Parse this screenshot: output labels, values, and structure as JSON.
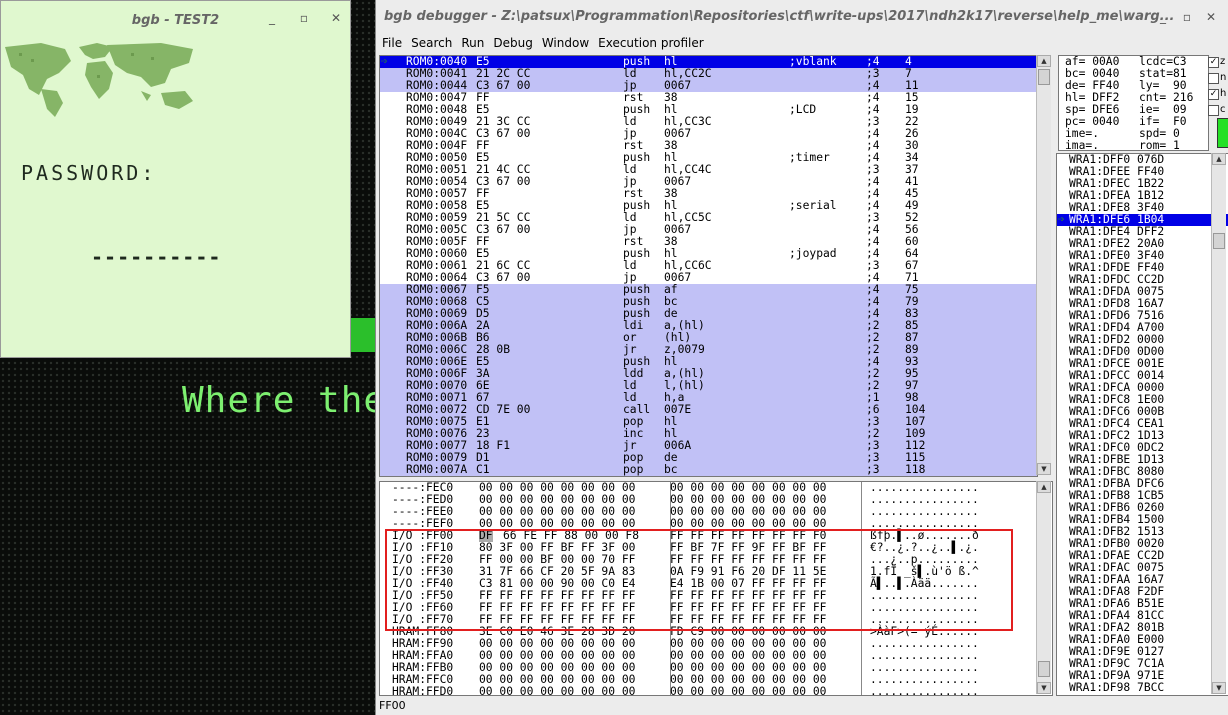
{
  "background": {
    "terminal_text": "Where the"
  },
  "emulator": {
    "title": "bgb - TEST2",
    "password_label": "PASSWORD:",
    "password_value": "----------"
  },
  "debugger": {
    "title": "bgb debugger - Z:\\patsux\\Programmation\\Repositories\\ctf\\write-ups\\2017\\ndh2k17\\reverse\\help_me\\warg...",
    "menu": [
      "File",
      "Search",
      "Run",
      "Debug",
      "Window",
      "Execution profiler"
    ],
    "menu_underline": [
      "F",
      "S",
      "R",
      "D",
      "W",
      "E"
    ],
    "status": "FF00"
  },
  "code_rows": [
    {
      "addr": "ROM0:0040",
      "bytes": "E5",
      "mn": "push",
      "op": "hl",
      "cm": ";vblank",
      "cy": ";4",
      "tot": "4",
      "style": "sel",
      "pc": true
    },
    {
      "addr": "ROM0:0041",
      "bytes": "21 2C CC",
      "mn": "ld",
      "op": "hl,CC2C",
      "cm": "",
      "cy": ";3",
      "tot": "7",
      "style": "hl"
    },
    {
      "addr": "ROM0:0044",
      "bytes": "C3 67 00",
      "mn": "jp",
      "op": "0067",
      "cm": "",
      "cy": ";4",
      "tot": "11",
      "style": "hl"
    },
    {
      "addr": "ROM0:0047",
      "bytes": "FF",
      "mn": "rst",
      "op": "38",
      "cm": "",
      "cy": ";4",
      "tot": "15",
      "style": ""
    },
    {
      "addr": "ROM0:0048",
      "bytes": "E5",
      "mn": "push",
      "op": "hl",
      "cm": ";LCD",
      "cy": ";4",
      "tot": "19",
      "style": ""
    },
    {
      "addr": "ROM0:0049",
      "bytes": "21 3C CC",
      "mn": "ld",
      "op": "hl,CC3C",
      "cm": "",
      "cy": ";3",
      "tot": "22",
      "style": ""
    },
    {
      "addr": "ROM0:004C",
      "bytes": "C3 67 00",
      "mn": "jp",
      "op": "0067",
      "cm": "",
      "cy": ";4",
      "tot": "26",
      "style": ""
    },
    {
      "addr": "ROM0:004F",
      "bytes": "FF",
      "mn": "rst",
      "op": "38",
      "cm": "",
      "cy": ";4",
      "tot": "30",
      "style": ""
    },
    {
      "addr": "ROM0:0050",
      "bytes": "E5",
      "mn": "push",
      "op": "hl",
      "cm": ";timer",
      "cy": ";4",
      "tot": "34",
      "style": ""
    },
    {
      "addr": "ROM0:0051",
      "bytes": "21 4C CC",
      "mn": "ld",
      "op": "hl,CC4C",
      "cm": "",
      "cy": ";3",
      "tot": "37",
      "style": ""
    },
    {
      "addr": "ROM0:0054",
      "bytes": "C3 67 00",
      "mn": "jp",
      "op": "0067",
      "cm": "",
      "cy": ";4",
      "tot": "41",
      "style": ""
    },
    {
      "addr": "ROM0:0057",
      "bytes": "FF",
      "mn": "rst",
      "op": "38",
      "cm": "",
      "cy": ";4",
      "tot": "45",
      "style": ""
    },
    {
      "addr": "ROM0:0058",
      "bytes": "E5",
      "mn": "push",
      "op": "hl",
      "cm": ";serial",
      "cy": ";4",
      "tot": "49",
      "style": ""
    },
    {
      "addr": "ROM0:0059",
      "bytes": "21 5C CC",
      "mn": "ld",
      "op": "hl,CC5C",
      "cm": "",
      "cy": ";3",
      "tot": "52",
      "style": ""
    },
    {
      "addr": "ROM0:005C",
      "bytes": "C3 67 00",
      "mn": "jp",
      "op": "0067",
      "cm": "",
      "cy": ";4",
      "tot": "56",
      "style": ""
    },
    {
      "addr": "ROM0:005F",
      "bytes": "FF",
      "mn": "rst",
      "op": "38",
      "cm": "",
      "cy": ";4",
      "tot": "60",
      "style": ""
    },
    {
      "addr": "ROM0:0060",
      "bytes": "E5",
      "mn": "push",
      "op": "hl",
      "cm": ";joypad",
      "cy": ";4",
      "tot": "64",
      "style": ""
    },
    {
      "addr": "ROM0:0061",
      "bytes": "21 6C CC",
      "mn": "ld",
      "op": "hl,CC6C",
      "cm": "",
      "cy": ";3",
      "tot": "67",
      "style": ""
    },
    {
      "addr": "ROM0:0064",
      "bytes": "C3 67 00",
      "mn": "jp",
      "op": "0067",
      "cm": "",
      "cy": ";4",
      "tot": "71",
      "style": ""
    },
    {
      "addr": "ROM0:0067",
      "bytes": "F5",
      "mn": "push",
      "op": "af",
      "cm": "",
      "cy": ";4",
      "tot": "75",
      "style": "hl"
    },
    {
      "addr": "ROM0:0068",
      "bytes": "C5",
      "mn": "push",
      "op": "bc",
      "cm": "",
      "cy": ";4",
      "tot": "79",
      "style": "hl"
    },
    {
      "addr": "ROM0:0069",
      "bytes": "D5",
      "mn": "push",
      "op": "de",
      "cm": "",
      "cy": ";4",
      "tot": "83",
      "style": "hl"
    },
    {
      "addr": "ROM0:006A",
      "bytes": "2A",
      "mn": "ldi",
      "op": "a,(hl)",
      "cm": "",
      "cy": ";2",
      "tot": "85",
      "style": "hl"
    },
    {
      "addr": "ROM0:006B",
      "bytes": "B6",
      "mn": "or",
      "op": "(hl)",
      "cm": "",
      "cy": ";2",
      "tot": "87",
      "style": "hl"
    },
    {
      "addr": "ROM0:006C",
      "bytes": "28 0B",
      "mn": "jr",
      "op": "z,0079",
      "cm": "",
      "cy": ";2",
      "tot": "89",
      "style": "hl"
    },
    {
      "addr": "ROM0:006E",
      "bytes": "E5",
      "mn": "push",
      "op": "hl",
      "cm": "",
      "cy": ";4",
      "tot": "93",
      "style": "hl"
    },
    {
      "addr": "ROM0:006F",
      "bytes": "3A",
      "mn": "ldd",
      "op": "a,(hl)",
      "cm": "",
      "cy": ";2",
      "tot": "95",
      "style": "hl"
    },
    {
      "addr": "ROM0:0070",
      "bytes": "6E",
      "mn": "ld",
      "op": "l,(hl)",
      "cm": "",
      "cy": ";2",
      "tot": "97",
      "style": "hl"
    },
    {
      "addr": "ROM0:0071",
      "bytes": "67",
      "mn": "ld",
      "op": "h,a",
      "cm": "",
      "cy": ";1",
      "tot": "98",
      "style": "hl"
    },
    {
      "addr": "ROM0:0072",
      "bytes": "CD 7E 00",
      "mn": "call",
      "op": "007E",
      "cm": "",
      "cy": ";6",
      "tot": "104",
      "style": "hl"
    },
    {
      "addr": "ROM0:0075",
      "bytes": "E1",
      "mn": "pop",
      "op": "hl",
      "cm": "",
      "cy": ";3",
      "tot": "107",
      "style": "hl"
    },
    {
      "addr": "ROM0:0076",
      "bytes": "23",
      "mn": "inc",
      "op": "hl",
      "cm": "",
      "cy": ";2",
      "tot": "109",
      "style": "hl"
    },
    {
      "addr": "ROM0:0077",
      "bytes": "18 F1",
      "mn": "jr",
      "op": "006A",
      "cm": "",
      "cy": ";3",
      "tot": "112",
      "style": "hl"
    },
    {
      "addr": "ROM0:0079",
      "bytes": "D1",
      "mn": "pop",
      "op": "de",
      "cm": "",
      "cy": ";3",
      "tot": "115",
      "style": "hl"
    },
    {
      "addr": "ROM0:007A",
      "bytes": "C1",
      "mn": "pop",
      "op": "bc",
      "cm": "",
      "cy": ";3",
      "tot": "118",
      "style": "hl"
    }
  ],
  "memory_rows": [
    {
      "addr": "----:FEC0",
      "h1": "00 00 00 00 00 00 00 00",
      "h2": "00 00 00 00 00 00 00 00",
      "asc": "................"
    },
    {
      "addr": "----:FED0",
      "h1": "00 00 00 00 00 00 00 00",
      "h2": "00 00 00 00 00 00 00 00",
      "asc": "................"
    },
    {
      "addr": "----:FEE0",
      "h1": "00 00 00 00 00 00 00 00",
      "h2": "00 00 00 00 00 00 00 00",
      "asc": "................"
    },
    {
      "addr": "----:FEF0",
      "h1": "00 00 00 00 00 00 00 00",
      "h2": "00 00 00 00 00 00 00 00",
      "asc": "................"
    },
    {
      "addr": "I/O :FF00",
      "first": "DF",
      "h1": "66 FE FF 88 00 00 F8",
      "h2": "FF FF FF FF FF FF FF F0",
      "asc": "ßfþ.▌..ø.......ð"
    },
    {
      "addr": "I/O :FF10",
      "h1": "80 3F 00 FF BF FF 3F 00",
      "h2": "FF BF 7F FF 9F FF BF FF",
      "asc": "€?..¿.?..¿..▌.¿."
    },
    {
      "addr": "I/O :FF20",
      "h1": "FF 00 00 BF 00 00 70 FF",
      "h2": "FF FF FF FF FF FF FF FF",
      "asc": "...¿..p........."
    },
    {
      "addr": "I/O :FF30",
      "h1": "31 7F 66 CF 20 5F 9A 83",
      "h2": "0A F9 91 F6 20 DF 11 5E",
      "asc": "1.fÏ _š▌.ù'ö ß.^"
    },
    {
      "addr": "I/O :FF40",
      "h1": "C3 81 00 00 90 00 C0 E4",
      "h2": "E4 1B 00 07 FF FF FF FF",
      "asc": "Ã▌..▌.Àää......."
    },
    {
      "addr": "I/O :FF50",
      "h1": "FF FF FF FF FF FF FF FF",
      "h2": "FF FF FF FF FF FF FF FF",
      "asc": "................"
    },
    {
      "addr": "I/O :FF60",
      "h1": "FF FF FF FF FF FF FF FF",
      "h2": "FF FF FF FF FF FF FF FF",
      "asc": "................"
    },
    {
      "addr": "I/O :FF70",
      "h1": "FF FF FF FF FF FF FF FF",
      "h2": "FF FF FF FF FF FF FF FF",
      "asc": "................"
    },
    {
      "addr": "HRAM:FF80",
      "h1": "3E C0 E0 46 3E 28 3D 20",
      "h2": "FD C9 00 00 00 00 00 00",
      "asc": ">ÀàF>(= ýÉ......"
    },
    {
      "addr": "HRAM:FF90",
      "h1": "00 00 00 00 00 00 00 00",
      "h2": "00 00 00 00 00 00 00 00",
      "asc": "................"
    },
    {
      "addr": "HRAM:FFA0",
      "h1": "00 00 00 00 00 00 00 00",
      "h2": "00 00 00 00 00 00 00 00",
      "asc": "................"
    },
    {
      "addr": "HRAM:FFB0",
      "h1": "00 00 00 00 00 00 00 00",
      "h2": "00 00 00 00 00 00 00 00",
      "asc": "................"
    },
    {
      "addr": "HRAM:FFC0",
      "h1": "00 00 00 00 00 00 00 00",
      "h2": "00 00 00 00 00 00 00 00",
      "asc": "................"
    },
    {
      "addr": "HRAM:FFD0",
      "h1": "00 00 00 00 00 00 00 00",
      "h2": "00 00 00 00 00 00 00 00",
      "asc": "................"
    }
  ],
  "registers": [
    {
      "l": "af= 00A0",
      "r": "lcdc=C3"
    },
    {
      "l": "bc= 0040",
      "r": "stat=81"
    },
    {
      "l": "de= FF40",
      "r": "ly=  90"
    },
    {
      "l": "hl= DFF2",
      "r": "cnt= 216"
    },
    {
      "l": "sp= DFE6",
      "r": "ie=  09"
    },
    {
      "l": "pc= 0040",
      "r": "if=  F0"
    },
    {
      "l": "ime=.",
      "r": "spd= 0"
    },
    {
      "l": "ima=.",
      "r": "rom= 1"
    }
  ],
  "flags": [
    {
      "label": "z",
      "checked": true
    },
    {
      "label": "n",
      "checked": false
    },
    {
      "label": "h",
      "checked": true
    },
    {
      "label": "c",
      "checked": false
    }
  ],
  "stack_rows": [
    {
      "t": "WRA1:DFF0 076D",
      "sel": false
    },
    {
      "t": "WRA1:DFEE FF40",
      "sel": false
    },
    {
      "t": "WRA1:DFEC 1B22",
      "sel": false
    },
    {
      "t": "WRA1:DFEA 1B12",
      "sel": false
    },
    {
      "t": "WRA1:DFE8 3F40",
      "sel": false
    },
    {
      "t": "WRA1:DFE6 1B04",
      "sel": true
    },
    {
      "t": "WRA1:DFE4 DFF2",
      "sel": false
    },
    {
      "t": "WRA1:DFE2 20A0",
      "sel": false
    },
    {
      "t": "WRA1:DFE0 3F40",
      "sel": false
    },
    {
      "t": "WRA1:DFDE FF40",
      "sel": false
    },
    {
      "t": "WRA1:DFDC CC2D",
      "sel": false
    },
    {
      "t": "WRA1:DFDA 0075",
      "sel": false
    },
    {
      "t": "WRA1:DFD8 16A7",
      "sel": false
    },
    {
      "t": "WRA1:DFD6 7516",
      "sel": false
    },
    {
      "t": "WRA1:DFD4 A700",
      "sel": false
    },
    {
      "t": "WRA1:DFD2 0000",
      "sel": false
    },
    {
      "t": "WRA1:DFD0 0D00",
      "sel": false
    },
    {
      "t": "WRA1:DFCE 001E",
      "sel": false
    },
    {
      "t": "WRA1:DFCC 0014",
      "sel": false
    },
    {
      "t": "WRA1:DFCA 0000",
      "sel": false
    },
    {
      "t": "WRA1:DFC8 1E00",
      "sel": false
    },
    {
      "t": "WRA1:DFC6 000B",
      "sel": false
    },
    {
      "t": "WRA1:DFC4 CEA1",
      "sel": false
    },
    {
      "t": "WRA1:DFC2 1D13",
      "sel": false
    },
    {
      "t": "WRA1:DFC0 0DC2",
      "sel": false
    },
    {
      "t": "WRA1:DFBE 1D13",
      "sel": false
    },
    {
      "t": "WRA1:DFBC 8080",
      "sel": false
    },
    {
      "t": "WRA1:DFBA DFC6",
      "sel": false
    },
    {
      "t": "WRA1:DFB8 1CB5",
      "sel": false
    },
    {
      "t": "WRA1:DFB6 0260",
      "sel": false
    },
    {
      "t": "WRA1:DFB4 1500",
      "sel": false
    },
    {
      "t": "WRA1:DFB2 1513",
      "sel": false
    },
    {
      "t": "WRA1:DFB0 0020",
      "sel": false
    },
    {
      "t": "WRA1:DFAE CC2D",
      "sel": false
    },
    {
      "t": "WRA1:DFAC 0075",
      "sel": false
    },
    {
      "t": "WRA1:DFAA 16A7",
      "sel": false
    },
    {
      "t": "WRA1:DFA8 F2DF",
      "sel": false
    },
    {
      "t": "WRA1:DFA6 B51E",
      "sel": false
    },
    {
      "t": "WRA1:DFA4 81CC",
      "sel": false
    },
    {
      "t": "WRA1:DFA2 801B",
      "sel": false
    },
    {
      "t": "WRA1:DFA0 E000",
      "sel": false
    },
    {
      "t": "WRA1:DF9E 0127",
      "sel": false
    },
    {
      "t": "WRA1:DF9C 7C1A",
      "sel": false
    },
    {
      "t": "WRA1:DF9A 971E",
      "sel": false
    },
    {
      "t": "WRA1:DF98 7BCC",
      "sel": false
    }
  ],
  "colors": {
    "selection": "#0000e6",
    "highlight": "#c1c1f6",
    "annotation_box": "#e21f1f",
    "gameboy_bg": "#e0f8cf",
    "gameboy_dark": "#7aa85a"
  },
  "icons": {
    "minimize": "minimize-icon",
    "maximize": "maximize-icon",
    "close": "close-icon",
    "pc_arrow": "arrow-right-icon",
    "world_map": "world-map-icon"
  }
}
